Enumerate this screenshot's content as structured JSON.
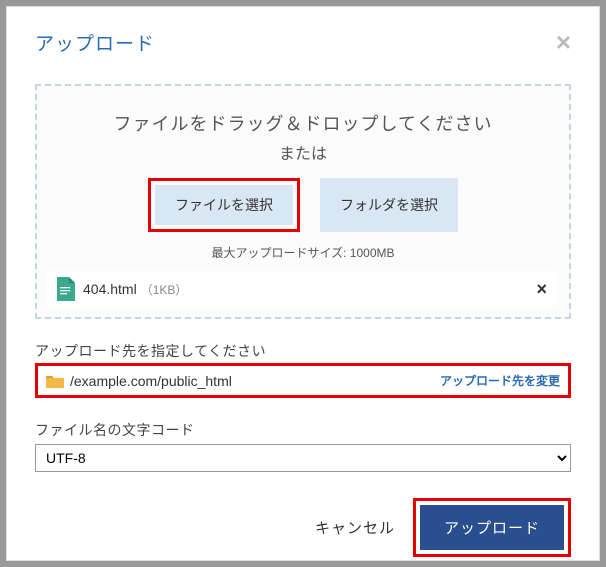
{
  "modal": {
    "title": "アップロード"
  },
  "dropzone": {
    "instruction": "ファイルをドラッグ＆ドロップしてください",
    "or_label": "または",
    "select_file_btn": "ファイルを選択",
    "select_folder_btn": "フォルダを選択",
    "max_size_label": "最大アップロードサイズ: 1000MB"
  },
  "file": {
    "name": "404.html",
    "size": "（1KB）"
  },
  "destination": {
    "section_label": "アップロード先を指定してください",
    "path": "/example.com/public_html",
    "change_label": "アップロード先を変更"
  },
  "encoding": {
    "section_label": "ファイル名の文字コード",
    "value": "UTF-8"
  },
  "footer": {
    "cancel": "キャンセル",
    "upload": "アップロード"
  }
}
